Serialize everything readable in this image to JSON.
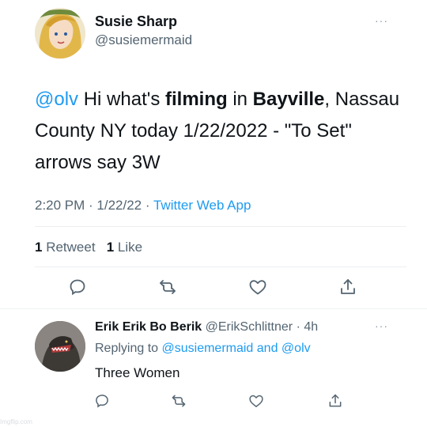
{
  "tweet": {
    "author_name": "Susie Sharp",
    "author_handle": "@susiemermaid",
    "more_glyph": "···",
    "text": {
      "mention": "@olv",
      "part1": " Hi what's ",
      "bold1": "filming",
      "part2": " in ",
      "bold2": "Bayville",
      "part3": ", Nassau County NY today 1/22/2022 - \"To Set\" arrows say 3W"
    },
    "time": "2:20 PM",
    "sep": " · ",
    "date": "1/22/22",
    "source": "Twitter Web App",
    "retweets_count": "1",
    "retweets_label": " Retweet",
    "likes_count": "1",
    "likes_label": " Like"
  },
  "reply": {
    "author_name": "Erik Erik Bo Berik",
    "author_handle": "@ErikSchlittner",
    "time_ago": "· 4h",
    "replying_prefix": "Replying to ",
    "replying_user1": "@susiemermaid",
    "replying_and": " and ",
    "replying_user2": "@olv",
    "text": "Three Women"
  },
  "watermark": "Imgflip.com",
  "colors": {
    "link": "#1d9bf0",
    "secondary_text": "#536471",
    "icon": "#536471",
    "divider": "#eceff1"
  },
  "icons": [
    "reply-icon",
    "retweet-icon",
    "like-icon",
    "share-icon"
  ]
}
